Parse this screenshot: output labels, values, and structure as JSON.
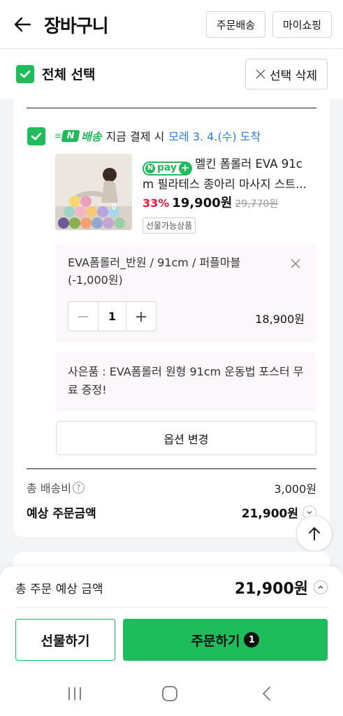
{
  "header": {
    "title": "장바구니",
    "order_delivery": "주문배송",
    "my_shopping": "마이쇼핑"
  },
  "selection": {
    "select_all": "전체 선택",
    "delete_selected": "선택 삭제"
  },
  "shipping": {
    "badge_letter": "N",
    "badge_text": "배송",
    "text": "지금 결제 시",
    "date": "모레 3. 4.(수) 도착"
  },
  "product": {
    "npay_n": "N",
    "npay_text": "pay",
    "npay_plus": "+",
    "name_line1": "멜킨 폼롤러 EVA 91c",
    "name_line2": "m 필라테스 종아리 마사지 스트...",
    "discount": "33%",
    "price": "19,900원",
    "original_price": "29,770원",
    "gift_tag": "선물가능상품"
  },
  "option": {
    "name": "EVA폼롤러_반원 / 91cm / 퍼플마블 (-1,000원)",
    "quantity": "1",
    "price": "18,900원"
  },
  "gift_note": "사은품 : EVA폼롤러 원형 91cm 운동법 포스터 무료 증정!",
  "option_change": "옵션 변경",
  "summary": {
    "shipping_fee_label": "총 배송비",
    "help_icon_text": "?",
    "shipping_fee": "3,000원",
    "estimated_label": "예상 주문금액",
    "estimated_value": "21,900원"
  },
  "bottom": {
    "total_label": "총 주문 예상 금액",
    "total_value": "21,900원",
    "gift_button": "선물하기",
    "order_button": "주문하기",
    "order_count": "1"
  },
  "colors": {
    "accent": "#1ebc5a",
    "discount": "#e51a3c",
    "date": "#2b7be0"
  }
}
